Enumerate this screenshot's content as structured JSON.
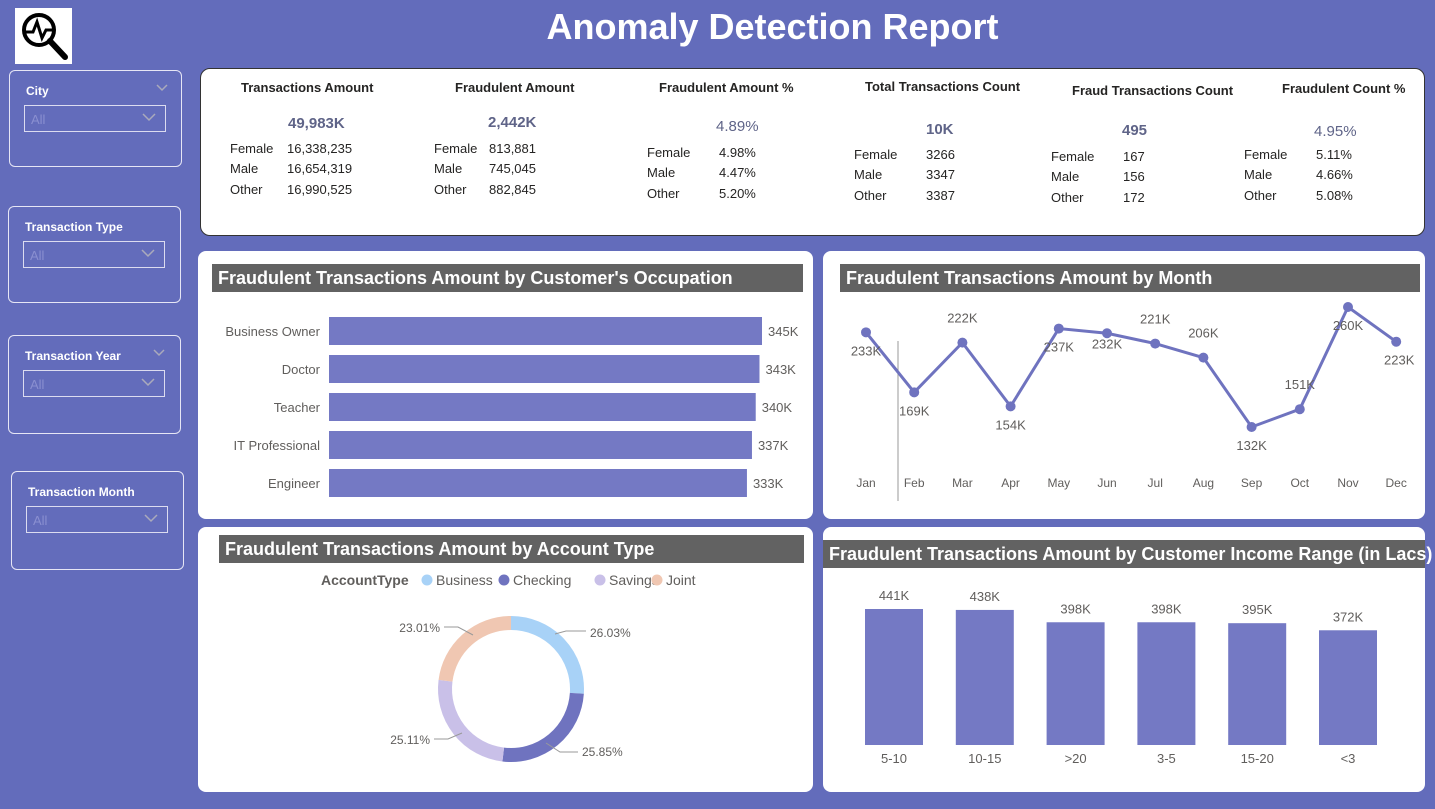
{
  "header": {
    "title": "Anomaly Detection Report"
  },
  "slicers": [
    {
      "label": "City",
      "value": "All"
    },
    {
      "label": "Transaction Type",
      "value": "All"
    },
    {
      "label": "Transaction Year",
      "value": "All"
    },
    {
      "label": "Transaction Month",
      "value": "All"
    }
  ],
  "kpis": [
    {
      "title": "Transactions Amount",
      "value": "49,983K",
      "rows": [
        [
          "Female",
          "16,338,235"
        ],
        [
          "Male",
          "16,654,319"
        ],
        [
          "Other",
          "16,990,525"
        ]
      ]
    },
    {
      "title": "Fraudulent Amount",
      "value": "2,442K",
      "rows": [
        [
          "Female",
          "813,881"
        ],
        [
          "Male",
          "745,045"
        ],
        [
          "Other",
          "882,845"
        ]
      ]
    },
    {
      "title": "Fraudulent Amount %",
      "value": "4.89%",
      "rows": [
        [
          "Female",
          "4.98%"
        ],
        [
          "Male",
          "4.47%"
        ],
        [
          "Other",
          "5.20%"
        ]
      ]
    },
    {
      "title": "Total Transactions Count",
      "value": "10K",
      "rows": [
        [
          "Female",
          "3266"
        ],
        [
          "Male",
          "3347"
        ],
        [
          "Other",
          "3387"
        ]
      ]
    },
    {
      "title": "Fraud Transactions Count",
      "value": "495",
      "rows": [
        [
          "Female",
          "167"
        ],
        [
          "Male",
          "156"
        ],
        [
          "Other",
          "172"
        ]
      ]
    },
    {
      "title": "Fraudulent Count %",
      "value": "4.95%",
      "rows": [
        [
          "Female",
          "5.11%"
        ],
        [
          "Male",
          "4.66%"
        ],
        [
          "Other",
          "5.08%"
        ]
      ]
    }
  ],
  "colors": {
    "bar": "#7479c4",
    "line": "#6f73bf",
    "business": "#a8d2f7",
    "checking": "#6f73bf",
    "savings": "#c9c0e8",
    "joint": "#f0c7b2",
    "background": "#636cbb",
    "title_bar": "#626262"
  },
  "chart_data": [
    {
      "type": "bar",
      "orientation": "horizontal",
      "title": "Fraudulent Transactions Amount by Customer's Occupation",
      "categories": [
        "Business Owner",
        "Doctor",
        "Teacher",
        "IT Professional",
        "Engineer"
      ],
      "values": [
        345000,
        343000,
        340000,
        337000,
        333000
      ],
      "labels": [
        "345K",
        "343K",
        "340K",
        "337K",
        "333K"
      ]
    },
    {
      "type": "line",
      "title": "Fraudulent Transactions Amount by Month",
      "categories": [
        "Jan",
        "Feb",
        "Mar",
        "Apr",
        "May",
        "Jun",
        "Jul",
        "Aug",
        "Sep",
        "Oct",
        "Nov",
        "Dec"
      ],
      "values": [
        233000,
        169000,
        222000,
        154000,
        237000,
        232000,
        221000,
        206000,
        132000,
        151000,
        260000,
        223000
      ],
      "labels": [
        "233K",
        "169K",
        "222K",
        "154K",
        "237K",
        "232K",
        "221K",
        "206K",
        "132K",
        "151K",
        "260K",
        "223K"
      ]
    },
    {
      "type": "pie",
      "title": "Fraudulent Transactions Amount by Account Type",
      "legend_title": "AccountType",
      "legend_position": "top",
      "categories": [
        "Business",
        "Checking",
        "Savings",
        "Joint"
      ],
      "values": [
        26.03,
        25.85,
        25.11,
        23.01
      ],
      "labels": [
        "26.03%",
        "25.85%",
        "25.11%",
        "23.01%"
      ]
    },
    {
      "type": "bar",
      "title": "Fraudulent Transactions Amount by Customer Income Range (in Lacs)",
      "categories": [
        "5-10",
        "10-15",
        ">20",
        "3-5",
        "15-20",
        "<3"
      ],
      "values": [
        441000,
        438000,
        398000,
        398000,
        395000,
        372000
      ],
      "labels": [
        "441K",
        "438K",
        "398K",
        "398K",
        "395K",
        "372K"
      ]
    }
  ]
}
